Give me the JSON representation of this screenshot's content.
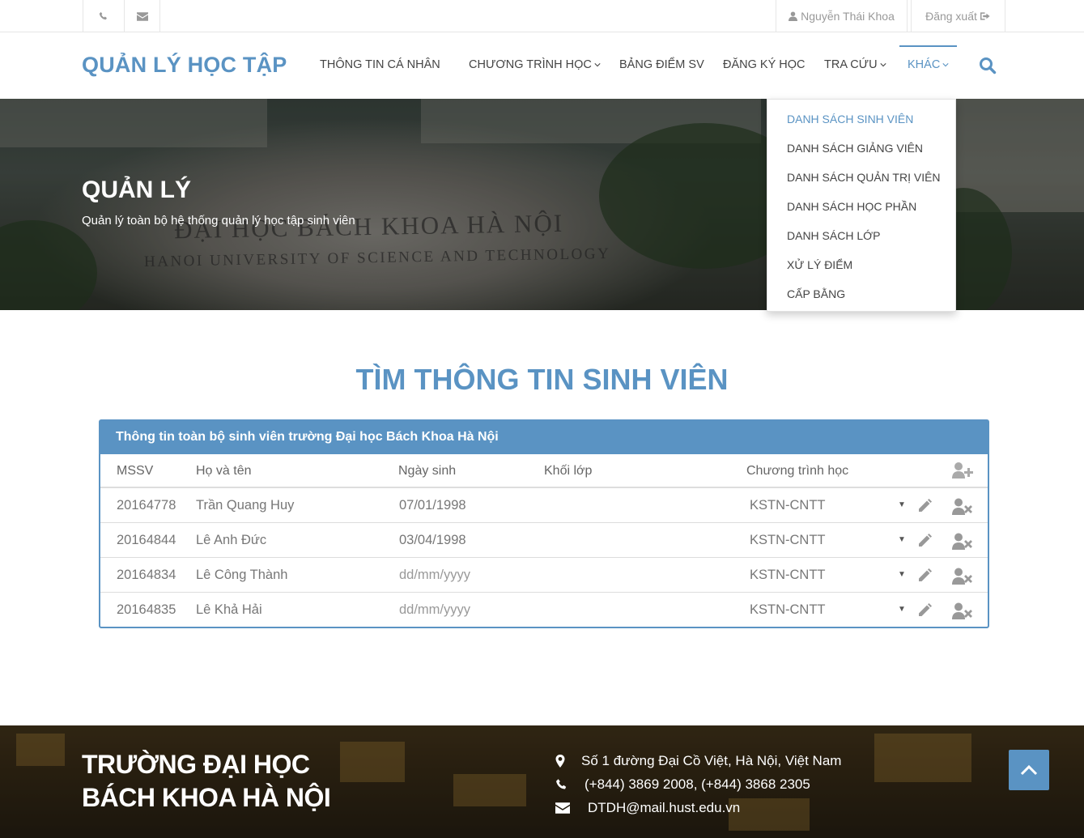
{
  "topbar": {
    "user_name": "Nguyễn Thái Khoa",
    "logout_label": "Đăng xuất"
  },
  "navbar": {
    "brand": "QUẢN LÝ HỌC TẬP",
    "items": [
      {
        "label": "THÔNG TIN CÁ NHÂN"
      },
      {
        "label": "CHƯƠNG TRÌNH HỌC"
      },
      {
        "label": "BẢNG ĐIỂM SV"
      },
      {
        "label": "ĐĂNG KÝ HỌC"
      },
      {
        "label": "TRA CỨU"
      },
      {
        "label": "KHÁC"
      }
    ]
  },
  "dropdown": {
    "items": [
      {
        "label": "DANH SÁCH SINH VIÊN"
      },
      {
        "label": "DANH SÁCH GIẢNG VIÊN"
      },
      {
        "label": "DANH SÁCH QUẢN TRỊ VIÊN"
      },
      {
        "label": "DANH SÁCH HỌC PHẦN"
      },
      {
        "label": "DANH SÁCH LỚP"
      },
      {
        "label": "XỬ LÝ ĐIỂM"
      },
      {
        "label": "CẤP BẰNG"
      }
    ]
  },
  "hero": {
    "title": "QUẢN LÝ",
    "subtitle": "Quản lý toàn bộ hệ thống quản lý học tập sinh viên",
    "stone_line1": "ĐẠI HỌC BÁCH KHOA HÀ NỘI",
    "stone_line2": "HANOI UNIVERSITY OF SCIENCE AND TECHNOLOGY"
  },
  "main": {
    "title": "TÌM THÔNG TIN SINH VIÊN",
    "panel_title": "Thông tin toàn bộ sinh viên trường Đại học Bách Khoa Hà Nội",
    "columns": [
      "MSSV",
      "Họ và tên",
      "Ngày sinh",
      "Khối lớp",
      "Chương trình học"
    ],
    "rows": [
      {
        "mssv": "20164778",
        "name": "Trần Quang Huy",
        "dob": "07/01/1998",
        "dob_placeholder": false,
        "class": "",
        "program": "KSTN-CNTT"
      },
      {
        "mssv": "20164844",
        "name": "Lê Anh Đức",
        "dob": "03/04/1998",
        "dob_placeholder": false,
        "class": "",
        "program": "KSTN-CNTT"
      },
      {
        "mssv": "20164834",
        "name": "Lê Công Thành",
        "dob": "dd/mm/yyyy",
        "dob_placeholder": true,
        "class": "",
        "program": "KSTN-CNTT"
      },
      {
        "mssv": "20164835",
        "name": "Lê Khả Hải",
        "dob": "dd/mm/yyyy",
        "dob_placeholder": true,
        "class": "",
        "program": "KSTN-CNTT"
      }
    ]
  },
  "footer": {
    "title_line1": "TRƯỜNG ĐẠI HỌC",
    "title_line2": "BÁCH KHOA HÀ NỘI",
    "address": "Số 1 đường Đại Cồ Việt, Hà Nội, Việt Nam",
    "phone": "(+844) 3869 2008, (+844) 3868 2305",
    "email": "DTDH@mail.hust.edu.vn"
  },
  "colors": {
    "accent": "#5a93c3"
  },
  "icons": [
    "phone-icon",
    "envelope-icon",
    "user-icon",
    "sign-out-icon",
    "search-icon",
    "user-plus-icon",
    "pencil-icon",
    "user-times-icon",
    "map-marker-icon",
    "chevron-up-icon"
  ]
}
